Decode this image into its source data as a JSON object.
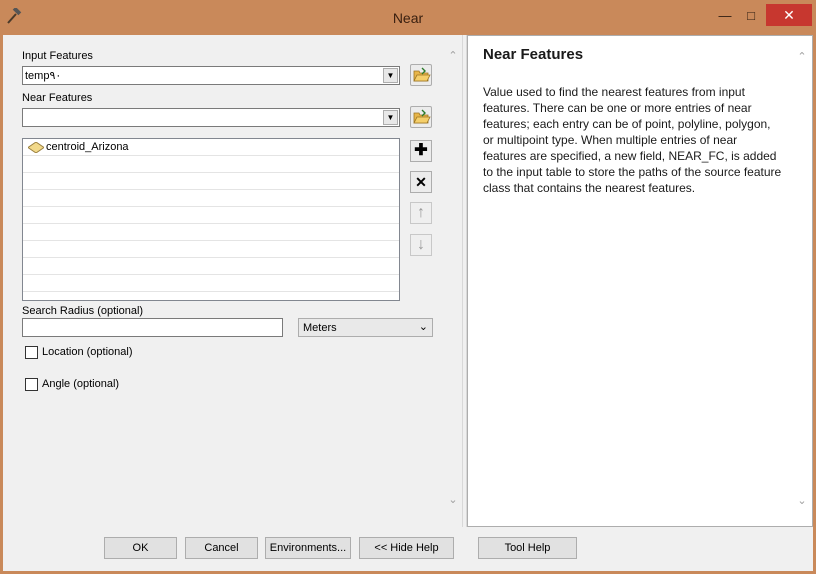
{
  "window": {
    "title": "Near",
    "minimize_glyph": "—",
    "maximize_glyph": "□",
    "close_glyph": "✕"
  },
  "form": {
    "input_features": {
      "label": "Input Features",
      "value": "temp٩٠"
    },
    "near_features": {
      "label": "Near Features",
      "value": "",
      "items": [
        "centroid_Arizona"
      ]
    },
    "list_buttons": {
      "add_glyph": "✚",
      "remove_glyph": "✕",
      "up_glyph": "↑",
      "down_glyph": "↓"
    },
    "search_radius": {
      "label": "Search Radius (optional)",
      "value": "",
      "unit": "Meters"
    },
    "location": {
      "label": "Location (optional)",
      "checked": false
    },
    "angle": {
      "label": "Angle (optional)",
      "checked": false
    }
  },
  "help": {
    "title": "Near Features",
    "body": "Value used to find the nearest features from input features. There can be one or more entries of near features; each entry can be of point, polyline, polygon, or multipoint type. When multiple entries of near features are specified, a new field, NEAR_FC, is added to the input table to store the paths of the source feature class that contains the nearest features."
  },
  "buttons": {
    "ok": "OK",
    "cancel": "Cancel",
    "environments": "Environments...",
    "hide_help": "<< Hide Help",
    "tool_help": "Tool Help"
  },
  "colors": {
    "title_bar": "#c9895a",
    "close_button": "#c7372f",
    "panel": "#f0f0f0"
  },
  "icons": [
    "hammer-icon",
    "folder-open-icon",
    "point-feature-icon",
    "add-icon",
    "remove-icon",
    "move-up-icon",
    "move-down-icon",
    "chevron-up-icon",
    "chevron-down-icon"
  ]
}
